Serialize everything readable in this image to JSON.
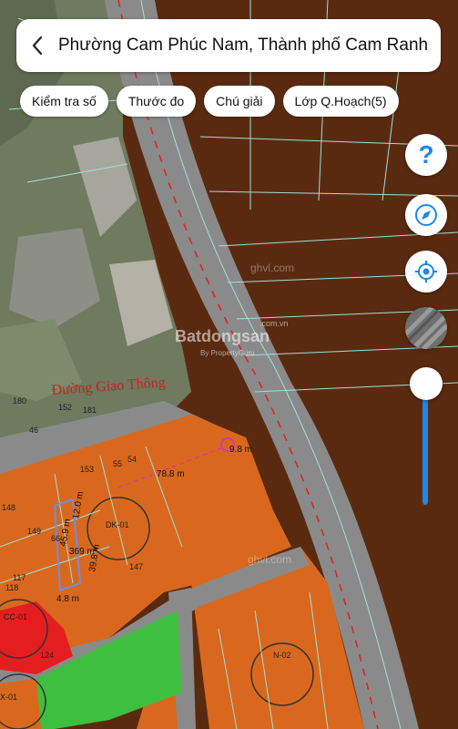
{
  "header": {
    "title": "Phường Cam Phúc Nam, Thành phố Cam Ranh"
  },
  "toolbar": {
    "chips": [
      {
        "label": "Kiểm tra số"
      },
      {
        "label": "Thước đo"
      },
      {
        "label": "Chú giải"
      },
      {
        "label": "Lớp Q.Hoạch(5)"
      }
    ]
  },
  "map": {
    "road_label": "Đường Giao Thông",
    "watermark": "Batdongsan",
    "watermark_domain": ".com.vn",
    "watermark_sub": "By PropertyGuru",
    "ghost_label": "ghvl.com",
    "parcel_numbers": [
      "180",
      "152",
      "181",
      "46",
      "153",
      "55",
      "54",
      "148",
      "149",
      "66",
      "147",
      "117",
      "118",
      "124"
    ],
    "zone_codes": [
      "DK-01",
      "CC-01",
      "X-01",
      "N-02"
    ],
    "measurements": [
      "78.8 m",
      "12.0 m",
      "45.9 m",
      "39.8 m",
      "4.8 m",
      "9.8 m"
    ],
    "area_label": "369 m²",
    "colors": {
      "dark_zone": "#5a2a10",
      "orange_zone": "#d9681e",
      "red_zone": "#e41e1e",
      "green_zone": "#3fbf3f",
      "road": "#8a8a8a",
      "parcel_lines": "#9fe0d8",
      "accent": "#1e88e5",
      "measure_line": "#d63aa0"
    }
  },
  "controls": {
    "help": "?",
    "icons": [
      "compass-icon",
      "locate-icon",
      "layer-thumbnail"
    ]
  }
}
